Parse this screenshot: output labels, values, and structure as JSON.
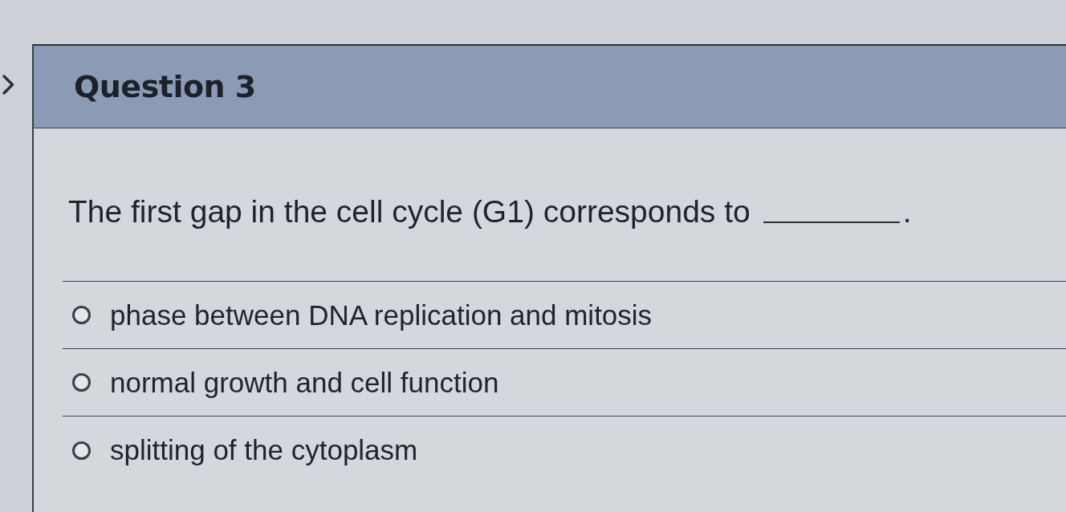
{
  "question": {
    "title": "Question 3",
    "prompt": [
      {
        "kind": "text",
        "text": "The first gap in the cell cycle (G1) corresponds to"
      },
      {
        "kind": "blank"
      },
      {
        "kind": "text",
        "text": "."
      }
    ],
    "options": [
      {
        "text": "phase between DNA replication and mitosis",
        "selected": false
      },
      {
        "text": "normal growth and cell function",
        "selected": false
      },
      {
        "text": "splitting of the cytoplasm",
        "selected": false
      }
    ]
  }
}
